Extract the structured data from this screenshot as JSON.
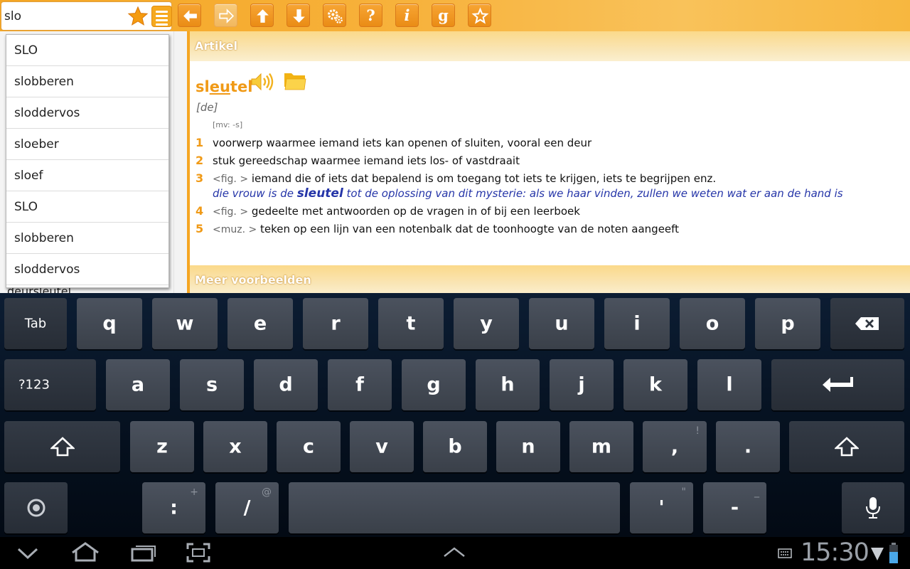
{
  "search": {
    "value": "slo",
    "placeholder": ""
  },
  "toolbar": {
    "buttons": [
      {
        "name": "back-button",
        "icon": "arrow-left-icon"
      },
      {
        "name": "forward-button",
        "icon": "arrow-right-icon"
      },
      {
        "name": "up-button",
        "icon": "arrow-up-icon"
      },
      {
        "name": "down-button",
        "icon": "arrow-down-icon"
      },
      {
        "name": "settings-button",
        "icon": "gears-icon"
      },
      {
        "name": "help-button",
        "icon": "question-icon",
        "glyph": "?"
      },
      {
        "name": "info-button",
        "icon": "info-icon",
        "glyph": "i"
      },
      {
        "name": "grammar-button",
        "icon": "g-icon",
        "glyph": "g"
      },
      {
        "name": "favorite-button",
        "icon": "star-outline-icon"
      }
    ]
  },
  "dropdown": {
    "items": [
      "SLO",
      "slobberen",
      "sloddervos",
      "sloeber",
      "sloef",
      "SLO",
      "slobberen",
      "sloddervos"
    ]
  },
  "left_list": {
    "partial_item": "deursleutel"
  },
  "article": {
    "header": "Artikel",
    "headword_pre": "sl",
    "headword_ul": "eu",
    "headword_post": "tel",
    "grammar": "[de]",
    "plural": "[mv: -s]",
    "senses": [
      {
        "num": "1",
        "context": "",
        "text": "voorwerp waarmee iemand iets kan openen of sluiten, vooral een deur"
      },
      {
        "num": "2",
        "context": "",
        "text": "stuk gereedschap waarmee iemand iets los- of vastdraait"
      },
      {
        "num": "3",
        "context": "<fig. >",
        "text": "iemand die of iets dat bepalend is om toegang tot iets te krijgen, iets te begrijpen enz."
      },
      {
        "num": "4",
        "context": "<fig. >",
        "text": "gedeelte met antwoorden op de vragen in of bij een leerboek"
      },
      {
        "num": "5",
        "context": "<muz. >",
        "text": "teken op een lijn van een notenbalk dat de toonhoogte van de noten aangeeft"
      }
    ],
    "example": {
      "pre": "die vrouw is de ",
      "bold": "sleutel",
      "post": " tot de oplossing van dit mysterie: als we haar vinden, zullen we weten wat er aan de hand is"
    },
    "more_header": "Meer voorbeelden"
  },
  "keyboard": {
    "row1": [
      "Tab",
      "q",
      "w",
      "e",
      "r",
      "t",
      "y",
      "u",
      "i",
      "o",
      "p"
    ],
    "row2": [
      "?123",
      "a",
      "s",
      "d",
      "f",
      "g",
      "h",
      "j",
      "k",
      "l"
    ],
    "row3": [
      "z",
      "x",
      "c",
      "v",
      "b",
      "n",
      "m",
      ",",
      "."
    ],
    "row3_alts": {
      ",": "!",
      ".": "?"
    },
    "row4": [
      ":",
      "/",
      "'",
      "-"
    ],
    "row4_alts": {
      ":": "+",
      "/": "@",
      "'": "\"",
      "-": "_"
    }
  },
  "status": {
    "time": "15:30"
  },
  "colors": {
    "accent": "#f5a623",
    "headword": "#f09a17",
    "example": "#2535a8",
    "keyboard_bg": "#0c1d33"
  }
}
